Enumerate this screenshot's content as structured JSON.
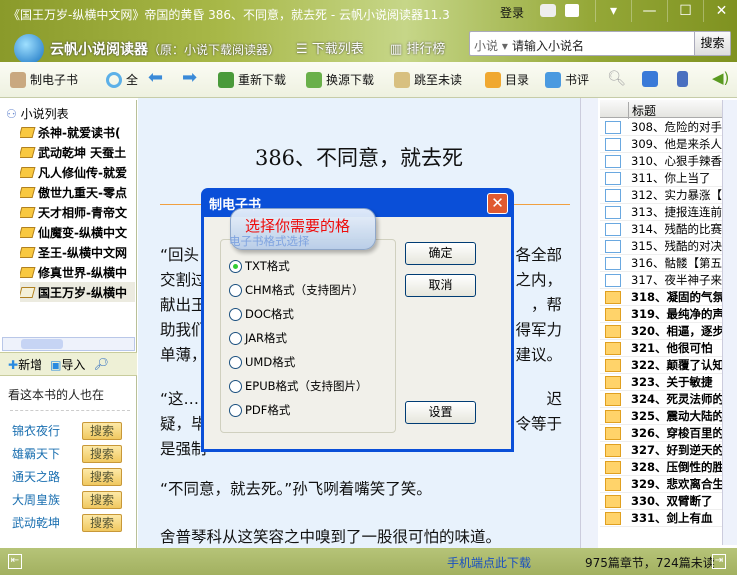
{
  "window": {
    "title": "《国王万岁-纵横中文网》帝国的黄昏 386、不同意，就去死 - 云帆小说阅读器11.3",
    "login": "登录",
    "controls": [
      "▾",
      "—",
      "☐",
      "✕"
    ]
  },
  "header": {
    "app_name": "云帆小说阅读器",
    "app_sub": "（原：小说下载阅读器）",
    "nav": [
      "下载列表",
      "排行榜"
    ],
    "search": {
      "scope": "小说",
      "placeholder": "请输入小说名",
      "button": "搜索"
    }
  },
  "toolbar": {
    "items": [
      "制电子书",
      "全",
      "重新下载",
      "换源下载",
      "跳至未读",
      "目录",
      "书评"
    ]
  },
  "sidebar": {
    "root": "小说列表",
    "books": [
      "杀神-就爱读书(",
      "武动乾坤 天蚕土",
      "凡人修仙传-就爱",
      "傲世九重天-零点",
      "天才相师-青帝文",
      "仙魔变-纵横中文",
      "圣王-纵横中文网",
      "修真世界-纵横中",
      "国王万岁-纵横中"
    ],
    "actions": [
      "新增",
      "导入"
    ],
    "related_title": "看这本书的人也在",
    "related": [
      "锦衣夜行",
      "雄霸天下",
      "通天之路",
      "大周皇族",
      "武动乾坤"
    ],
    "related_button": "搜索"
  },
  "reader": {
    "chapter_title": "386、不同意，就去死",
    "lines_left": [
      "“回头",
      "交割过",
      "献出王",
      "助我们",
      "单薄，",
      "“这…",
      "疑，毕",
      "是强制"
    ],
    "lines_right": [
      "各全部",
      "之内，",
      "，帮",
      "得军力",
      "建议。",
      "迟",
      "令等于",
      ""
    ],
    "para_full": [
      "“不同意，就去死。”孙飞咧着嘴笑了笑。",
      "舍普琴科从这笑容之中嗅到了一股很可怕的味道。"
    ]
  },
  "chapters": {
    "header": "标题",
    "items": [
      {
        "t": "308、危险的对手",
        "read": true
      },
      {
        "t": "309、他是来杀人",
        "read": true
      },
      {
        "t": "310、心狠手辣香",
        "read": true
      },
      {
        "t": "311、你上当了",
        "read": true
      },
      {
        "t": "312、实力暴涨【",
        "read": true
      },
      {
        "t": "313、捷报连连前",
        "read": true
      },
      {
        "t": "314、残酷的比赛",
        "read": true
      },
      {
        "t": "315、残酷的对决",
        "read": true
      },
      {
        "t": "316、骷髅【第五",
        "read": true
      },
      {
        "t": "317、夜半神子来",
        "read": true
      },
      {
        "t": "318、凝固的气氛",
        "read": false
      },
      {
        "t": "319、最纯净的声",
        "read": false
      },
      {
        "t": "320、相逼，逐步",
        "read": false
      },
      {
        "t": "321、他很可怕",
        "read": false
      },
      {
        "t": "322、颠覆了认知",
        "read": false
      },
      {
        "t": "323、关于敏捷",
        "read": false
      },
      {
        "t": "324、死灵法师的",
        "read": false
      },
      {
        "t": "325、震动大陆的",
        "read": false
      },
      {
        "t": "326、穿梭百里的",
        "read": false
      },
      {
        "t": "327、好到逆天的",
        "read": false
      },
      {
        "t": "328、压倒性的胜",
        "read": false
      },
      {
        "t": "329、悲欢离合生",
        "read": false
      },
      {
        "t": "330、双臂断了",
        "read": false
      },
      {
        "t": "331、剑上有血",
        "read": false
      }
    ]
  },
  "status": {
    "mobile_link": "手机端点此下载",
    "counts": "975篇章节，724篇未读"
  },
  "dialog": {
    "title": "制电子书",
    "tooltip": "选择你需要的格",
    "group_label": "电子书格式选择",
    "formats": [
      "TXT格式",
      "CHM格式（支持图片）",
      "DOC格式",
      "JAR格式",
      "UMD格式",
      "EPUB格式（支持图片）",
      "PDF格式"
    ],
    "selected": 0,
    "ok": "确定",
    "cancel": "取消",
    "settings": "设置"
  }
}
